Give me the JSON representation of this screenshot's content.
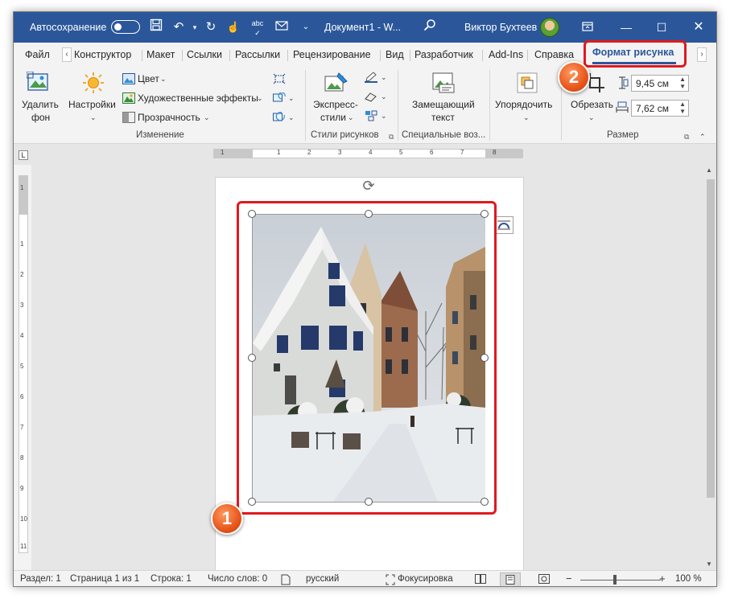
{
  "titlebar": {
    "autosave_label": "Автосохранение",
    "document_title": "Документ1  -  W...",
    "user_name": "Виктор Бухтеев"
  },
  "tabs": [
    {
      "label": "Файл"
    },
    {
      "label": "Конструктор"
    },
    {
      "label": "Макет"
    },
    {
      "label": "Ссылки"
    },
    {
      "label": "Рассылки"
    },
    {
      "label": "Рецензирование"
    },
    {
      "label": "Вид"
    },
    {
      "label": "Разработчик"
    },
    {
      "label": "Add-Ins"
    },
    {
      "label": "Справка"
    }
  ],
  "active_tab": "Формат рисунка",
  "ribbon": {
    "remove_bg_line1": "Удалить",
    "remove_bg_line2": "фон",
    "corrections": "Настройки",
    "color": "Цвет",
    "artistic": "Художественные эффекты",
    "transparency": "Прозрачность",
    "group_adjust": "Изменение",
    "quick_styles_line1": "Экспресс-",
    "quick_styles_line2": "стили",
    "group_styles": "Стили рисунков",
    "alt_text_line1": "Замещающий",
    "alt_text_line2": "текст",
    "group_accessibility": "Специальные воз...",
    "arrange": "Упорядочить",
    "crop": "Обрезать",
    "height_value": "9,45 см",
    "width_value": "7,62 см",
    "group_size": "Размер"
  },
  "ruler": {
    "h_numbers": [
      "1",
      "1",
      "2",
      "3",
      "4",
      "5",
      "6",
      "7",
      "8"
    ],
    "v_numbers": [
      "1",
      "1",
      "2",
      "3",
      "4",
      "5",
      "6",
      "7",
      "8",
      "9",
      "10",
      "11"
    ]
  },
  "annotations": {
    "badge1": "1",
    "badge2": "2"
  },
  "statusbar": {
    "section": "Раздел: 1",
    "page": "Страница 1 из 1",
    "line": "Строка: 1",
    "word_count": "Число слов: 0",
    "language": "русский",
    "focus": "Фокусировка",
    "zoom": "100 %"
  }
}
